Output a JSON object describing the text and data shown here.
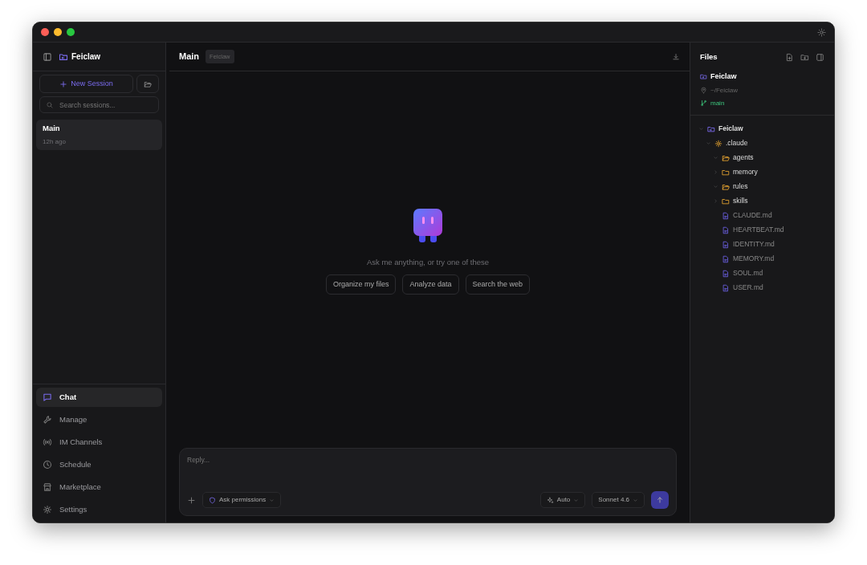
{
  "sidebar": {
    "project": "Feiclaw",
    "new_session": "New Session",
    "search": {
      "placeholder": "Search sessions..."
    },
    "sessions": [
      {
        "title": "Main",
        "time": "12h ago",
        "selected": true
      }
    ],
    "nav": [
      {
        "label": "Chat",
        "kind": "chat",
        "selected": true
      },
      {
        "label": "Manage",
        "kind": "wrench",
        "selected": false
      },
      {
        "label": "IM Channels",
        "kind": "radio",
        "selected": false
      },
      {
        "label": "Schedule",
        "kind": "clock",
        "selected": false
      },
      {
        "label": "Marketplace",
        "kind": "store",
        "selected": false
      },
      {
        "label": "Settings",
        "kind": "gear",
        "selected": false
      }
    ]
  },
  "main": {
    "title": "Main",
    "tag": "Feiclaw",
    "prompt": "Ask me anything, or try one of these",
    "suggestions": [
      "Organize my files",
      "Analyze data",
      "Search the web"
    ],
    "composer": {
      "placeholder": "Reply...",
      "permission": "Ask permissions",
      "mode": "Auto",
      "model": "Sonnet 4.6"
    }
  },
  "files": {
    "title": "Files",
    "project": {
      "name": "Feiclaw",
      "path": "~/Feiclaw",
      "branch": "main"
    },
    "tree": [
      {
        "name": "Feiclaw",
        "kind": "project",
        "expanded": true,
        "children": [
          {
            "name": ".claude",
            "kind": "config",
            "expanded": true,
            "children": [
              {
                "name": "agents",
                "kind": "folder",
                "expanded": true
              },
              {
                "name": "memory",
                "kind": "folder",
                "expanded": false
              },
              {
                "name": "rules",
                "kind": "folder",
                "expanded": true
              },
              {
                "name": "skills",
                "kind": "folder",
                "expanded": false
              },
              {
                "name": "CLAUDE.md",
                "kind": "file"
              },
              {
                "name": "HEARTBEAT.md",
                "kind": "file"
              },
              {
                "name": "IDENTITY.md",
                "kind": "file"
              },
              {
                "name": "MEMORY.md",
                "kind": "file"
              },
              {
                "name": "SOUL.md",
                "kind": "file"
              },
              {
                "name": "USER.md",
                "kind": "file"
              }
            ]
          }
        ]
      }
    ]
  }
}
